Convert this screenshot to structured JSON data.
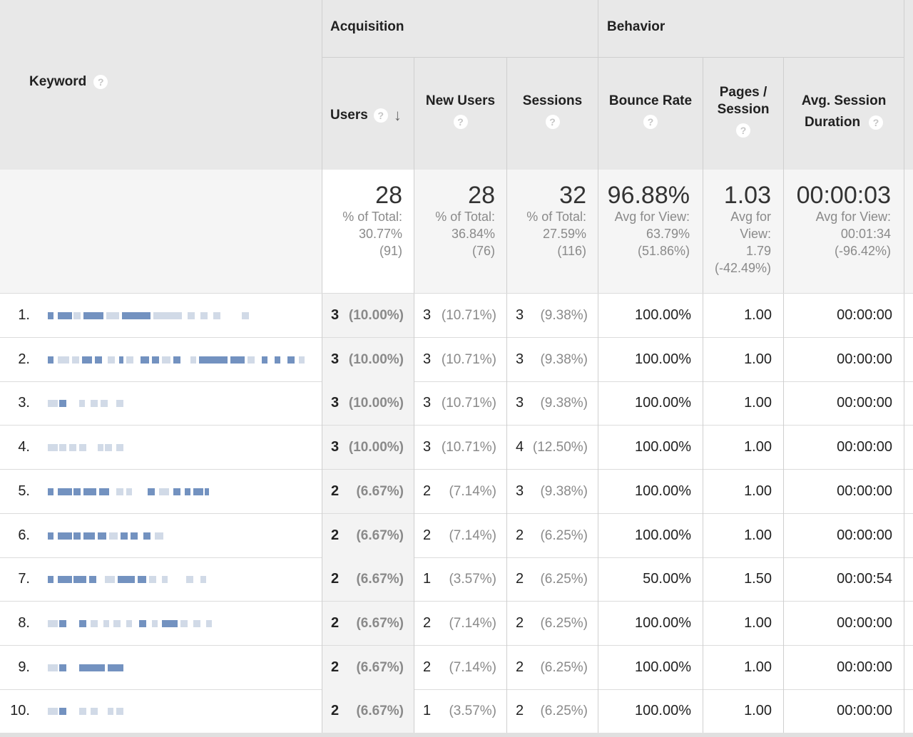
{
  "header": {
    "keyword_label": "Keyword",
    "acquisition_label": "Acquisition",
    "behavior_label": "Behavior",
    "columns": {
      "users": "Users",
      "new_users": "New Users",
      "sessions": "Sessions",
      "bounce_rate": "Bounce Rate",
      "pages_session_1": "Pages /",
      "pages_session_2": "Session",
      "avg_duration_1": "Avg. Session",
      "avg_duration_2": "Duration"
    },
    "help_glyph": "?",
    "sort_glyph": "↓"
  },
  "totals": {
    "users": {
      "value": "28",
      "l1": "% of Total:",
      "l2": "30.77%",
      "l3": "(91)"
    },
    "new_users": {
      "value": "28",
      "l1": "% of Total:",
      "l2": "36.84%",
      "l3": "(76)"
    },
    "sessions": {
      "value": "32",
      "l1": "% of Total:",
      "l2": "27.59%",
      "l3": "(116)"
    },
    "bounce_rate": {
      "value": "96.88%",
      "l1": "Avg for View:",
      "l2": "63.79%",
      "l3": "(51.86%)"
    },
    "pages_session": {
      "value": "1.03",
      "l1": "Avg for",
      "l2": "View:",
      "l3": "1.79",
      "l4": "(-42.49%)"
    },
    "avg_duration": {
      "value": "00:00:03",
      "l1": "Avg for View:",
      "l2": "00:01:34",
      "l3": "(-96.42%)"
    }
  },
  "rows": [
    {
      "num": "1.",
      "users": "3",
      "users_pct": "(10.00%)",
      "new_users": "3",
      "new_users_pct": "(10.71%)",
      "sessions": "3",
      "sessions_pct": "(9.38%)",
      "bounce": "100.00%",
      "pages": "1.00",
      "duration": "00:00:00"
    },
    {
      "num": "2.",
      "users": "3",
      "users_pct": "(10.00%)",
      "new_users": "3",
      "new_users_pct": "(10.71%)",
      "sessions": "3",
      "sessions_pct": "(9.38%)",
      "bounce": "100.00%",
      "pages": "1.00",
      "duration": "00:00:00"
    },
    {
      "num": "3.",
      "users": "3",
      "users_pct": "(10.00%)",
      "new_users": "3",
      "new_users_pct": "(10.71%)",
      "sessions": "3",
      "sessions_pct": "(9.38%)",
      "bounce": "100.00%",
      "pages": "1.00",
      "duration": "00:00:00"
    },
    {
      "num": "4.",
      "users": "3",
      "users_pct": "(10.00%)",
      "new_users": "3",
      "new_users_pct": "(10.71%)",
      "sessions": "4",
      "sessions_pct": "(12.50%)",
      "bounce": "100.00%",
      "pages": "1.00",
      "duration": "00:00:00"
    },
    {
      "num": "5.",
      "users": "2",
      "users_pct": "(6.67%)",
      "new_users": "2",
      "new_users_pct": "(7.14%)",
      "sessions": "3",
      "sessions_pct": "(9.38%)",
      "bounce": "100.00%",
      "pages": "1.00",
      "duration": "00:00:00"
    },
    {
      "num": "6.",
      "users": "2",
      "users_pct": "(6.67%)",
      "new_users": "2",
      "new_users_pct": "(7.14%)",
      "sessions": "2",
      "sessions_pct": "(6.25%)",
      "bounce": "100.00%",
      "pages": "1.00",
      "duration": "00:00:00"
    },
    {
      "num": "7.",
      "users": "2",
      "users_pct": "(6.67%)",
      "new_users": "1",
      "new_users_pct": "(3.57%)",
      "sessions": "2",
      "sessions_pct": "(6.25%)",
      "bounce": "50.00%",
      "pages": "1.50",
      "duration": "00:00:54"
    },
    {
      "num": "8.",
      "users": "2",
      "users_pct": "(6.67%)",
      "new_users": "2",
      "new_users_pct": "(7.14%)",
      "sessions": "2",
      "sessions_pct": "(6.25%)",
      "bounce": "100.00%",
      "pages": "1.00",
      "duration": "00:00:00"
    },
    {
      "num": "9.",
      "users": "2",
      "users_pct": "(6.67%)",
      "new_users": "2",
      "new_users_pct": "(7.14%)",
      "sessions": "2",
      "sessions_pct": "(6.25%)",
      "bounce": "100.00%",
      "pages": "1.00",
      "duration": "00:00:00"
    },
    {
      "num": "10.",
      "users": "2",
      "users_pct": "(6.67%)",
      "new_users": "1",
      "new_users_pct": "(3.57%)",
      "sessions": "2",
      "sessions_pct": "(6.25%)",
      "bounce": "100.00%",
      "pages": "1.00",
      "duration": "00:00:00"
    }
  ],
  "colors": {
    "header_bg": "#e8e8e8",
    "users_col_bg": "#f3f3f3",
    "blur_blue": "#5b7fb5",
    "blur_grey": "#c9d3e3"
  }
}
